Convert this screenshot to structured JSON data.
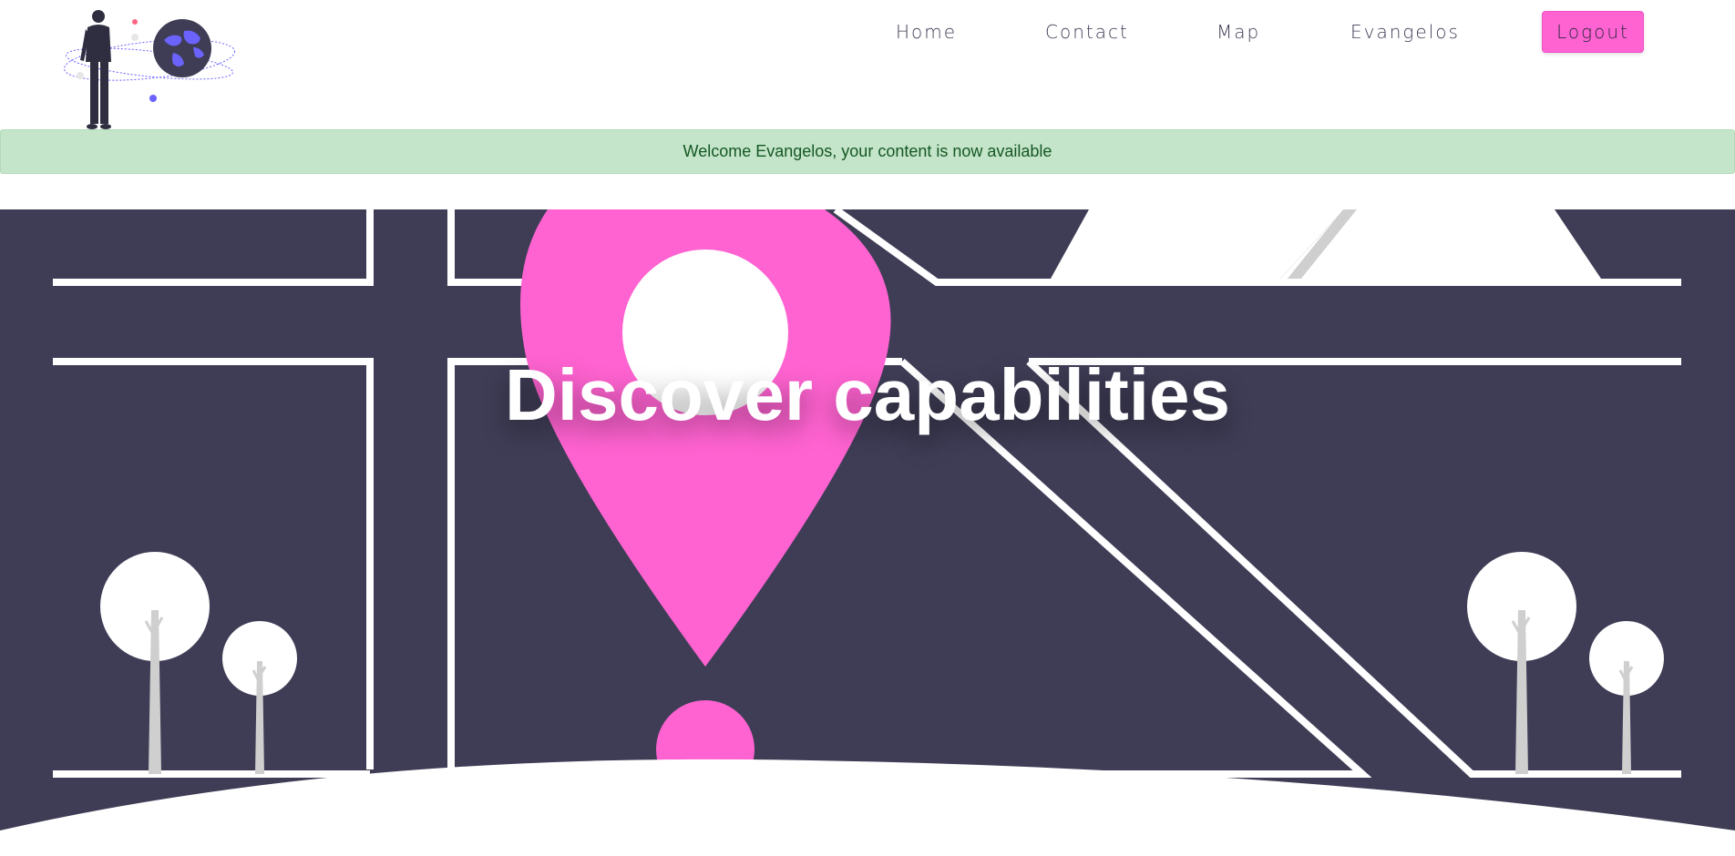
{
  "nav": {
    "logo_alt": "Globe traveller illustration",
    "links": [
      {
        "label": "Home"
      },
      {
        "label": "Contact"
      },
      {
        "label": "Map"
      },
      {
        "label": "Evangelos"
      }
    ],
    "logout_label": "Logout"
  },
  "alert": {
    "message": "Welcome Evangelos, your content is now available"
  },
  "hero": {
    "title": "Discover capabilities"
  },
  "colors": {
    "accent": "#ff63d1",
    "dark": "#3f3d56",
    "alert_bg": "#c4e5c9",
    "alert_text": "#155724",
    "globe": "#6c63ff"
  },
  "icons": {
    "logo": "person-with-globe-illustration",
    "map_pin": "map-pin-icon"
  }
}
